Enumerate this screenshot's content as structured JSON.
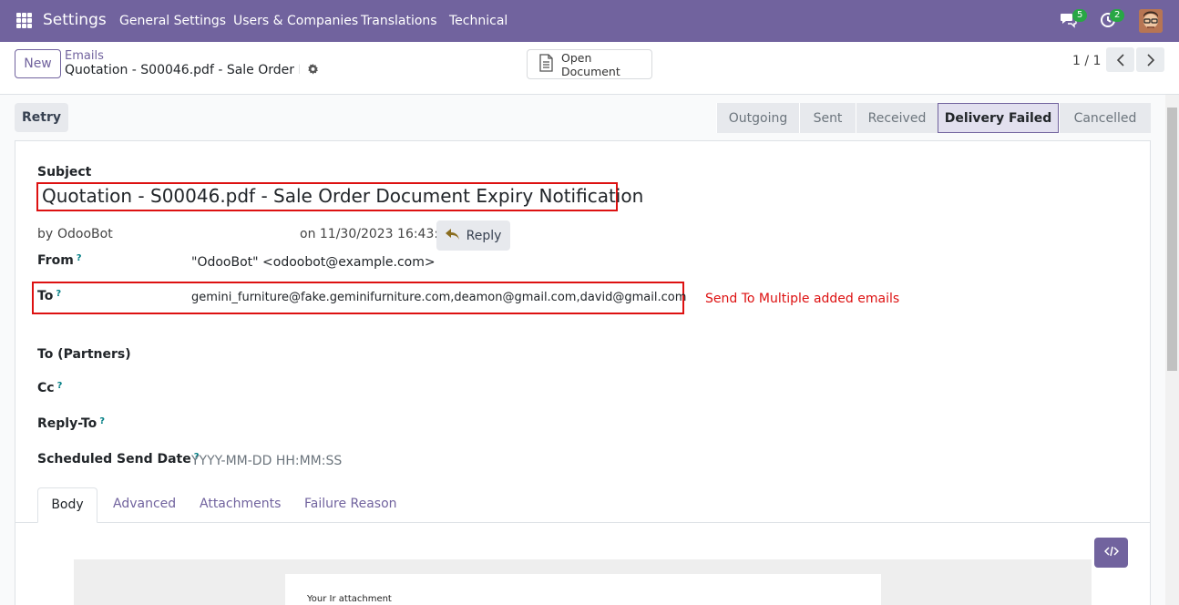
{
  "navbar": {
    "app_name": "Settings",
    "menu": [
      "General Settings",
      "Users & Companies",
      "Translations",
      "Technical"
    ],
    "messages_count": "5",
    "activities_count": "2"
  },
  "control_panel": {
    "new_label": "New",
    "breadcrumb_parent": "Emails",
    "breadcrumb_current": "Quotation - S00046.pdf - Sale Order D...",
    "open_document_label": "Open Document",
    "pager": "1 / 1"
  },
  "statusbar": {
    "retry_label": "Retry",
    "stages": [
      "Outgoing",
      "Sent",
      "Received",
      "Delivery Failed",
      "Cancelled"
    ],
    "active_stage": "Delivery Failed"
  },
  "form": {
    "subject_label": "Subject",
    "subject": "Quotation - S00046.pdf - Sale Order Document Expiry Notification",
    "by_label": "by",
    "author": "OdooBot",
    "date_text": "on 11/30/2023 16:43:16",
    "reply_label": "Reply",
    "from_label": "From",
    "from_value": "\"OdooBot\" <odoobot@example.com>",
    "to_label": "To",
    "to_value": "gemini_furniture@fake.geminifurniture.com,deamon@gmail.com,david@gmail.com",
    "annotation": "Send To Multiple added emails",
    "to_partners_label": "To (Partners)",
    "cc_label": "Cc",
    "reply_to_label": "Reply-To",
    "scheduled_label": "Scheduled Send Date",
    "scheduled_placeholder": "YYYY-MM-DD HH:MM:SS",
    "help_mark": "?"
  },
  "tabs": [
    "Body",
    "Advanced",
    "Attachments",
    "Failure Reason"
  ],
  "body_preview_text": "Your Ir attachment",
  "colors": {
    "brand": "#71639e",
    "highlight": "#dd1111",
    "badge": "#28a745"
  }
}
